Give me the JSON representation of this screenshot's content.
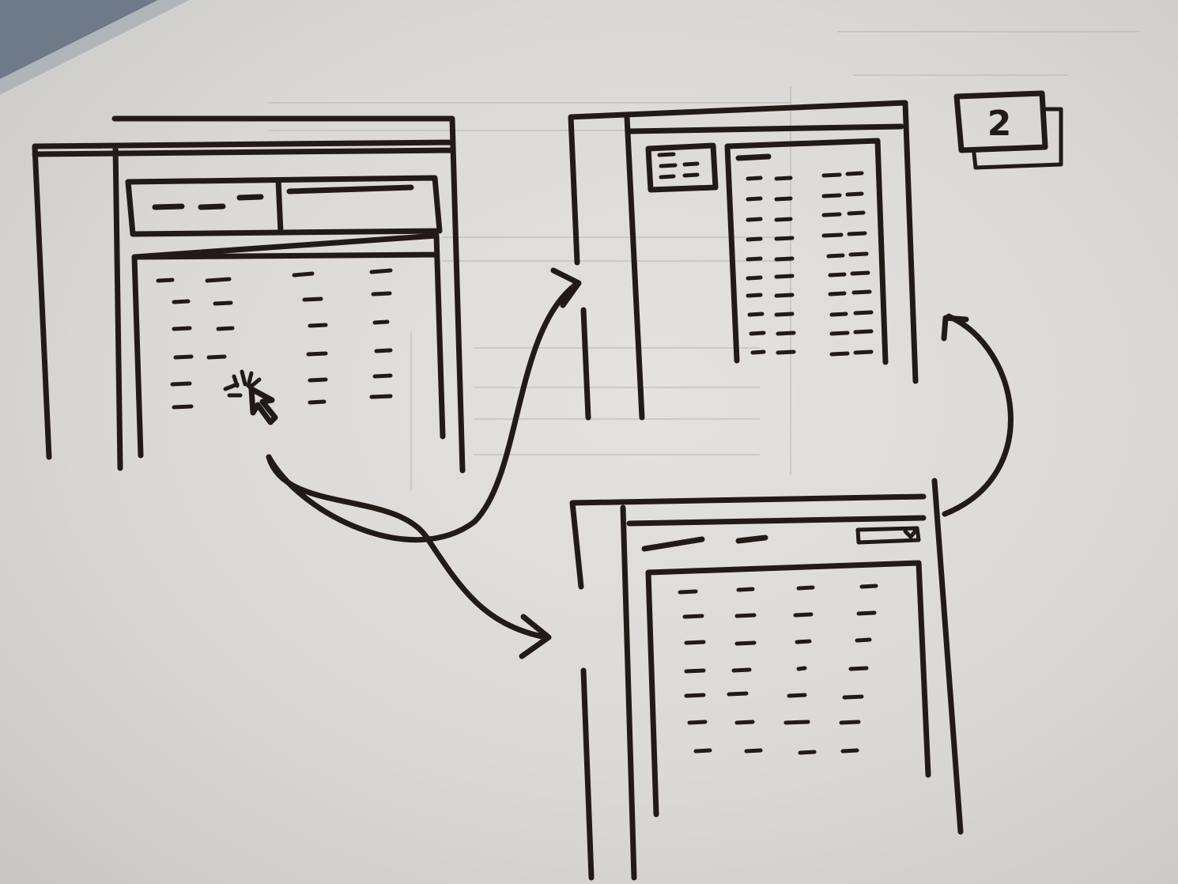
{
  "sketch": {
    "page_badge": "2",
    "colors": {
      "paper": "#dedcd9",
      "ink": "#221a17"
    }
  }
}
